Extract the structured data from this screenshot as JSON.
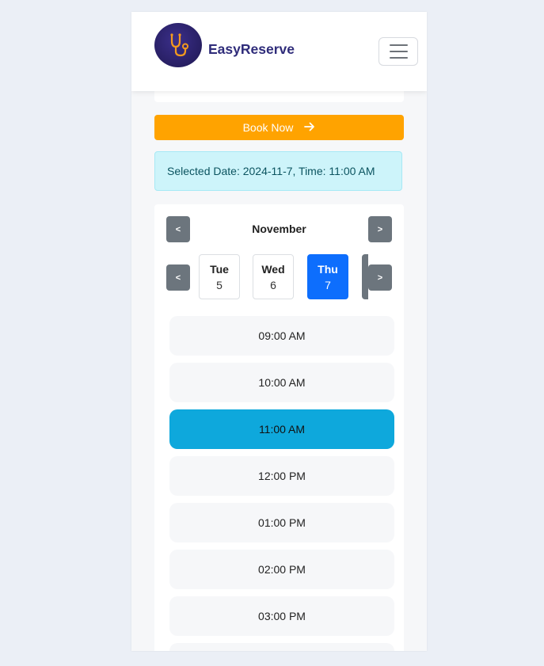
{
  "header": {
    "brand": "EasyReserve",
    "logo_icon": "stethoscope-icon",
    "menu_icon": "hamburger-menu-icon"
  },
  "book_button": {
    "label": "Book Now",
    "icon": "arrow-right-icon",
    "color": "#ffa300"
  },
  "alert": {
    "text": "Selected Date: 2024-11-7, Time: 11:00 AM"
  },
  "calendar": {
    "month": "November",
    "prev_month": "<",
    "next_month": ">",
    "prev_days": "<",
    "next_days": ">",
    "days": [
      {
        "name": "Tue",
        "date": "5",
        "selected": false
      },
      {
        "name": "Wed",
        "date": "6",
        "selected": false
      },
      {
        "name": "Thu",
        "date": "7",
        "selected": true
      }
    ],
    "slots": [
      "09:00 AM",
      "10:00 AM",
      "11:00 AM",
      "12:00 PM",
      "01:00 PM",
      "02:00 PM",
      "03:00 PM"
    ],
    "selected_slot": "11:00 AM",
    "accent": "#0d6efd",
    "slot_selected_color": "#0ea8dc"
  }
}
